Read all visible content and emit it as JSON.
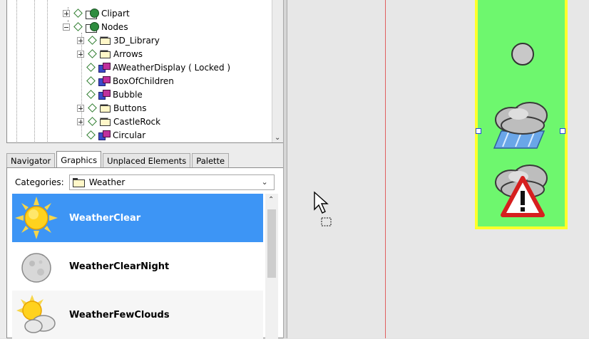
{
  "tree": {
    "items": [
      {
        "label": "Clipart",
        "icon": "library-icon",
        "expander": "plus"
      },
      {
        "label": "Nodes",
        "icon": "library-icon",
        "expander": "minus"
      },
      {
        "label": "3D_Library",
        "icon": "folder-icon",
        "expander": "plus"
      },
      {
        "label": "Arrows",
        "icon": "folder-icon",
        "expander": "plus"
      },
      {
        "label": "AWeatherDisplay ( Locked )",
        "icon": "node-icon",
        "expander": "none"
      },
      {
        "label": "BoxOfChildren",
        "icon": "node-icon",
        "expander": "none"
      },
      {
        "label": "Bubble",
        "icon": "node-icon",
        "expander": "none"
      },
      {
        "label": "Buttons",
        "icon": "folder-icon",
        "expander": "plus"
      },
      {
        "label": "CastleRock",
        "icon": "folder-icon",
        "expander": "plus"
      },
      {
        "label": "Circular",
        "icon": "node-icon",
        "expander": "none"
      }
    ]
  },
  "tabs": [
    {
      "label": "Navigator",
      "active": false
    },
    {
      "label": "Graphics",
      "active": true
    },
    {
      "label": "Unplaced Elements",
      "active": false
    },
    {
      "label": "Palette",
      "active": false
    }
  ],
  "categories": {
    "label": "Categories:",
    "selected": "Weather"
  },
  "graphics_list": [
    {
      "label": "WeatherClear",
      "selected": true,
      "icon": "sun-icon"
    },
    {
      "label": "WeatherClearNight",
      "selected": false,
      "icon": "moon-icon"
    },
    {
      "label": "WeatherFewClouds",
      "selected": false,
      "icon": "sun-cloud-icon"
    }
  ],
  "canvas": {
    "graphic_icons": [
      "grey-circle-icon",
      "rain-cloud-icon",
      "cloud-warning-icon"
    ],
    "colors": {
      "graphic_fill": "#6ef76e",
      "graphic_border": "#ffff2a",
      "selection": "#3d95f5",
      "page_edge": "#e06060"
    }
  }
}
